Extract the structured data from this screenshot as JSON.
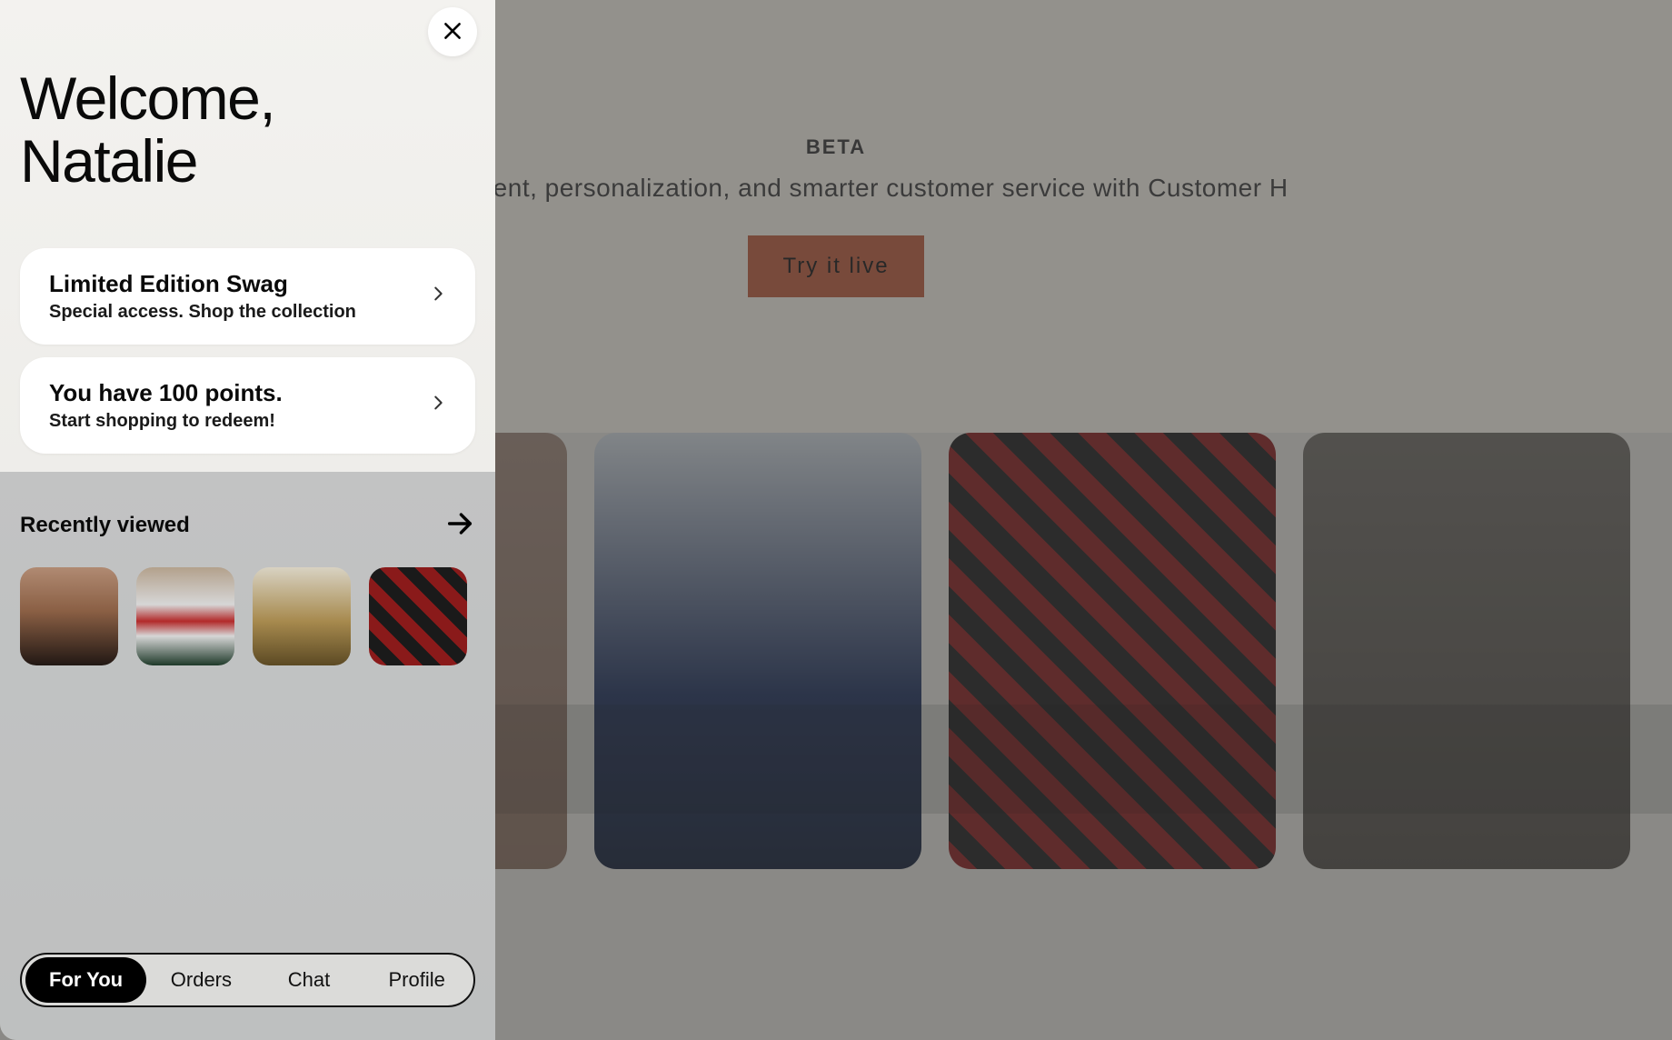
{
  "background": {
    "beta_label": "BETA",
    "tagline": "engagement, personalization, and smarter customer service with Customer H",
    "cta_label": "Try it live"
  },
  "panel": {
    "welcome_line1": "Welcome,",
    "welcome_line2": "Natalie",
    "cards": [
      {
        "title": "Limited Edition Swag",
        "subtitle": "Special access. Shop the collection"
      },
      {
        "title": "You have 100 points.",
        "subtitle": "Start shopping to redeem!"
      }
    ],
    "recent": {
      "title": "Recently viewed",
      "items": [
        {
          "name": "black-bag"
        },
        {
          "name": "varsity-jacket"
        },
        {
          "name": "yellow-sweater"
        },
        {
          "name": "red-plaid-shirt"
        }
      ]
    },
    "nav": [
      {
        "label": "For You",
        "active": true
      },
      {
        "label": "Orders",
        "active": false
      },
      {
        "label": "Chat",
        "active": false
      },
      {
        "label": "Profile",
        "active": false
      }
    ]
  }
}
